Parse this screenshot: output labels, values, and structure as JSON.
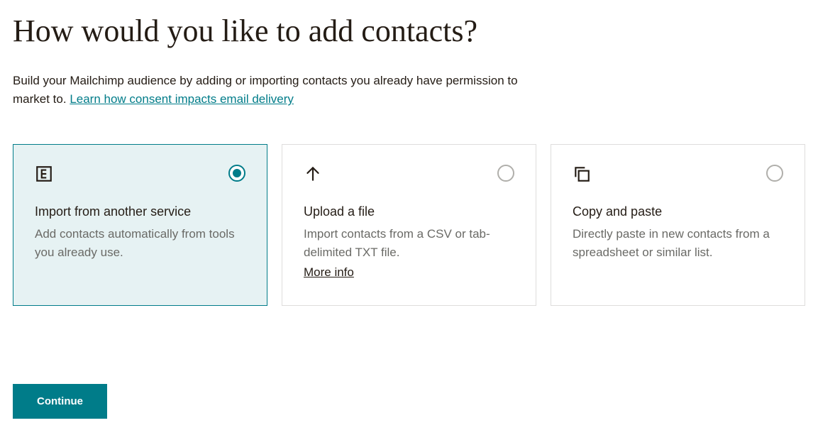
{
  "heading": "How would you like to add contacts?",
  "intro_text": "Build your Mailchimp audience by adding or importing contacts you already have permission to market to. ",
  "intro_link": "Learn how consent impacts email delivery",
  "cards": [
    {
      "title": "Import from another service",
      "desc": "Add contacts automatically from tools you already use.",
      "link": ""
    },
    {
      "title": "Upload a file",
      "desc": "Import contacts from a CSV or tab-delimited TXT file.",
      "link": "More info"
    },
    {
      "title": "Copy and paste",
      "desc": "Directly paste in new contacts from a spreadsheet or similar list.",
      "link": ""
    }
  ],
  "continue_label": "Continue",
  "selected_index": 0
}
